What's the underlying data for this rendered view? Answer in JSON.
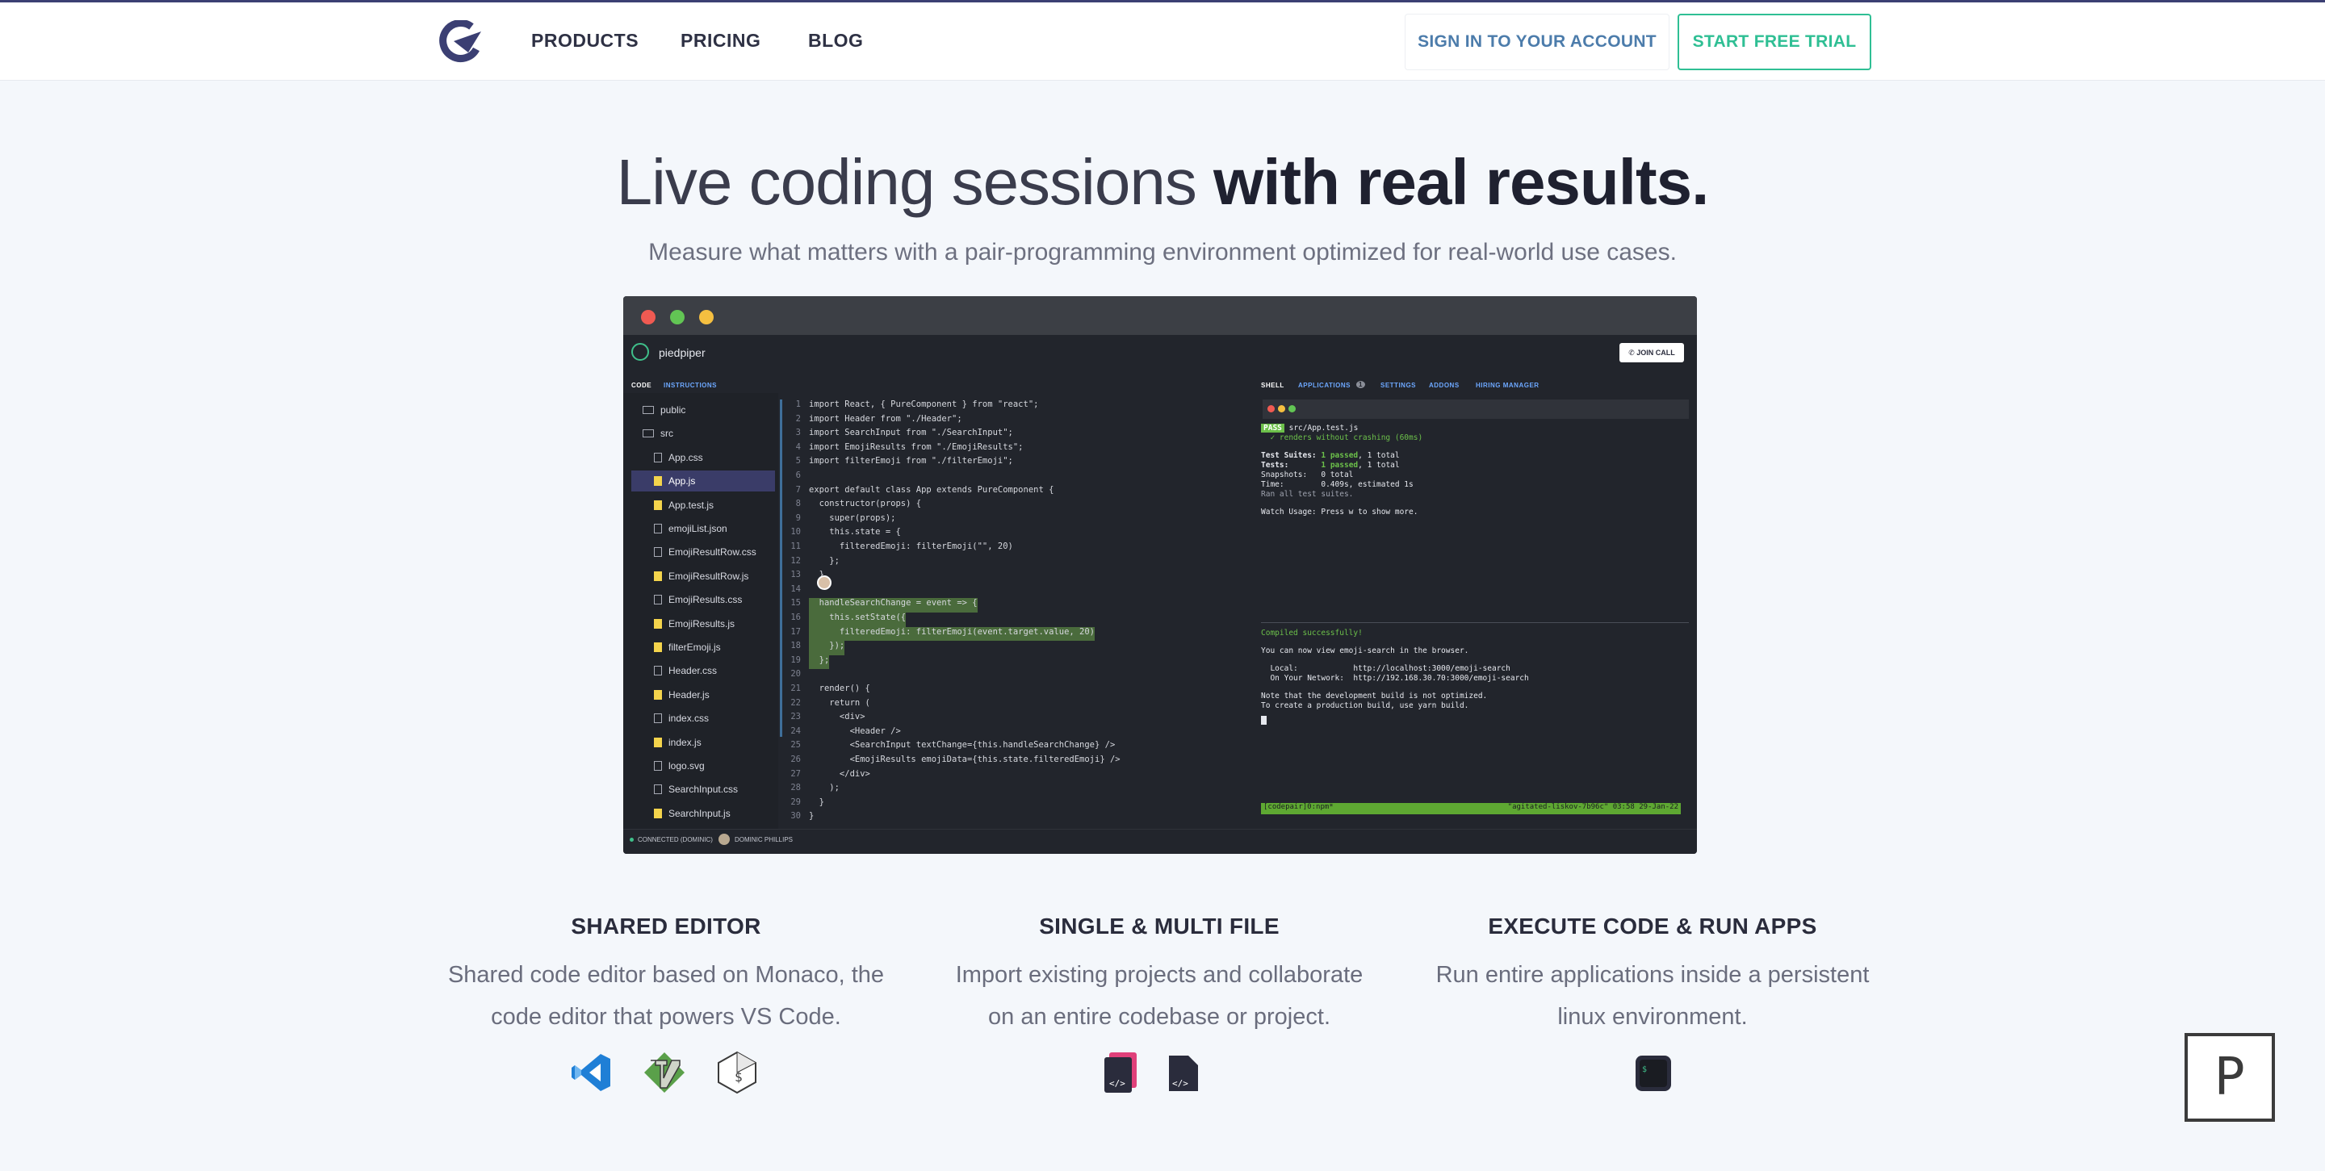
{
  "nav": {
    "links": [
      "PRODUCTS",
      "PRICING",
      "BLOG"
    ],
    "signin": "SIGN IN TO YOUR ACCOUNT",
    "trial": "START FREE TRIAL"
  },
  "hero": {
    "title_light": "Live coding sessions ",
    "title_bold": "with real results.",
    "subtitle": "Measure what matters with a pair-programming environment optimized for real-world use cases."
  },
  "app": {
    "name": "piedpiper",
    "join_call": "JOIN CALL",
    "left_tabs": [
      "CODE",
      "INSTRUCTIONS"
    ],
    "right_tabs": [
      "SHELL",
      "APPLICATIONS",
      "SETTINGS",
      "ADDONS",
      "HIRING MANAGER"
    ],
    "applications_badge": "1",
    "files": [
      {
        "name": "public",
        "type": "folder"
      },
      {
        "name": "src",
        "type": "folder"
      },
      {
        "name": "App.css",
        "type": "file"
      },
      {
        "name": "App.js",
        "type": "js",
        "selected": true
      },
      {
        "name": "App.test.js",
        "type": "js"
      },
      {
        "name": "emojiList.json",
        "type": "file"
      },
      {
        "name": "EmojiResultRow.css",
        "type": "file"
      },
      {
        "name": "EmojiResultRow.js",
        "type": "js"
      },
      {
        "name": "EmojiResults.css",
        "type": "file"
      },
      {
        "name": "EmojiResults.js",
        "type": "js"
      },
      {
        "name": "filterEmoji.js",
        "type": "js"
      },
      {
        "name": "Header.css",
        "type": "file"
      },
      {
        "name": "Header.js",
        "type": "js"
      },
      {
        "name": "index.css",
        "type": "file"
      },
      {
        "name": "index.js",
        "type": "js"
      },
      {
        "name": "logo.svg",
        "type": "file"
      },
      {
        "name": "SearchInput.css",
        "type": "file"
      },
      {
        "name": "SearchInput.js",
        "type": "js"
      }
    ],
    "code_lines": [
      "import React, { PureComponent } from \"react\";",
      "import Header from \"./Header\";",
      "import SearchInput from \"./SearchInput\";",
      "import EmojiResults from \"./EmojiResults\";",
      "import filterEmoji from \"./filterEmoji\";",
      "",
      "export default class App extends PureComponent {",
      "  constructor(props) {",
      "    super(props);",
      "    this.state = {",
      "      filteredEmoji: filterEmoji(\"\", 20)",
      "    };",
      "  }",
      "",
      "  handleSearchChange = event => {",
      "    this.setState({",
      "      filteredEmoji: filterEmoji(event.target.value, 20)",
      "    });",
      "  };",
      "",
      "  render() {",
      "    return (",
      "      <div>",
      "        <Header />",
      "        <SearchInput textChange={this.handleSearchChange} />",
      "        <EmojiResults emojiData={this.state.filteredEmoji} />",
      "      </div>",
      "    );",
      "  }",
      "}"
    ],
    "highlighted_lines": [
      15,
      16,
      17,
      18,
      19
    ],
    "terminal": {
      "pass_label": "PASS",
      "test_file": " src/App.test.js",
      "renders": "  ✓ renders without crashing (60ms)",
      "suites_label": "Test Suites:",
      "suites_passed": "1 passed",
      "suites_total": ", 1 total",
      "tests_label": "Tests:",
      "tests_passed": "1 passed",
      "tests_total": ", 1 total",
      "snapshots": "Snapshots:   0 total",
      "time": "Time:        0.409s, estimated 1s",
      "ran": "Ran all test suites.",
      "watch": "Watch Usage: Press w to show more.",
      "compiled": "Compiled successfully!",
      "view": "You can now view emoji-search in the browser.",
      "local": "  Local:            http://localhost:3000/emoji-search",
      "network": "  On Your Network:  http://192.168.30.70:3000/emoji-search",
      "note1": "Note that the development build is not optimized.",
      "note2": "To create a production build, use yarn build.",
      "statusbar_left": "[codepair]0:npm*",
      "statusbar_right": "\"agitated-liskov-7b96c\" 03:58 29-Jan-22"
    },
    "status_connected": "CONNECTED (DOMINIC)",
    "status_user": "DOMINIC PHILLIPS"
  },
  "features": [
    {
      "title": "SHARED EDITOR",
      "line1": "Shared code editor based on Monaco, the",
      "line2": "code editor that powers VS Code."
    },
    {
      "title": "SINGLE & MULTI FILE",
      "line1": "Import existing projects and collaborate",
      "line2": "on an entire codebase or project."
    },
    {
      "title": "EXECUTE CODE & RUN APPS",
      "line1": "Run entire applications inside a persistent",
      "line2": "linux environment."
    }
  ],
  "feature_icons": [
    [
      "vscode-icon",
      "vim-icon",
      "bash-icon"
    ],
    [
      "multi-file-icon",
      "single-file-icon"
    ],
    [
      "terminal-icon"
    ]
  ],
  "badge": "P",
  "colors": {
    "accent": "#2fbf94",
    "nav_link": "#4c7cab",
    "brand": "#3b3f73"
  }
}
